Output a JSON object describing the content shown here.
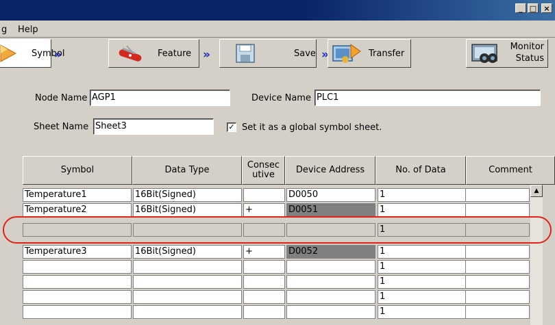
{
  "window": {
    "buttons": [
      "_",
      "□",
      "×"
    ]
  },
  "menu": {
    "items": [
      "g",
      "Help"
    ]
  },
  "toolbar": {
    "symbol": "Symbol",
    "feature": "Feature",
    "save": "Save",
    "transfer": "Transfer",
    "monitor_line1": "Monitor",
    "monitor_line2": "Status",
    "arrow": "»"
  },
  "form": {
    "node_name_label": "Node Name",
    "node_name_value": "AGP1",
    "device_name_label": "Device Name",
    "device_name_value": "PLC1",
    "sheet_name_label": "Sheet Name",
    "sheet_name_value": "Sheet3",
    "global_checkbox_checked": true,
    "global_checkbox_label": "Set it as a global symbol sheet."
  },
  "table": {
    "headers": [
      "Symbol",
      "Data Type",
      "Consec utive",
      "Device Address",
      "No. of Data",
      "Comment"
    ],
    "rows": [
      {
        "symbol": "Temperature1",
        "type": "16Bit(Signed)",
        "consec": "",
        "address": "D0050",
        "count": "1",
        "comment": ""
      },
      {
        "symbol": "Temperature2",
        "type": "16Bit(Signed)",
        "consec": "+",
        "address": "D0051",
        "count": "1",
        "comment": ""
      },
      {
        "symbol": "",
        "type": "",
        "consec": "",
        "address": "",
        "count": "1",
        "comment": ""
      },
      {
        "symbol": "Temperature3",
        "type": "16Bit(Signed)",
        "consec": "+",
        "address": "D0052",
        "count": "1",
        "comment": ""
      },
      {
        "symbol": "",
        "type": "",
        "consec": "",
        "address": "",
        "count": "1",
        "comment": ""
      },
      {
        "symbol": "",
        "type": "",
        "consec": "",
        "address": "",
        "count": "1",
        "comment": ""
      },
      {
        "symbol": "",
        "type": "",
        "consec": "",
        "address": "",
        "count": "1",
        "comment": ""
      },
      {
        "symbol": "",
        "type": "",
        "consec": "",
        "address": "",
        "count": "1",
        "comment": ""
      }
    ]
  },
  "colors": {
    "titlebar": "#0a246a",
    "highlight": "#e32119",
    "arrow": "#1a2dbf"
  }
}
